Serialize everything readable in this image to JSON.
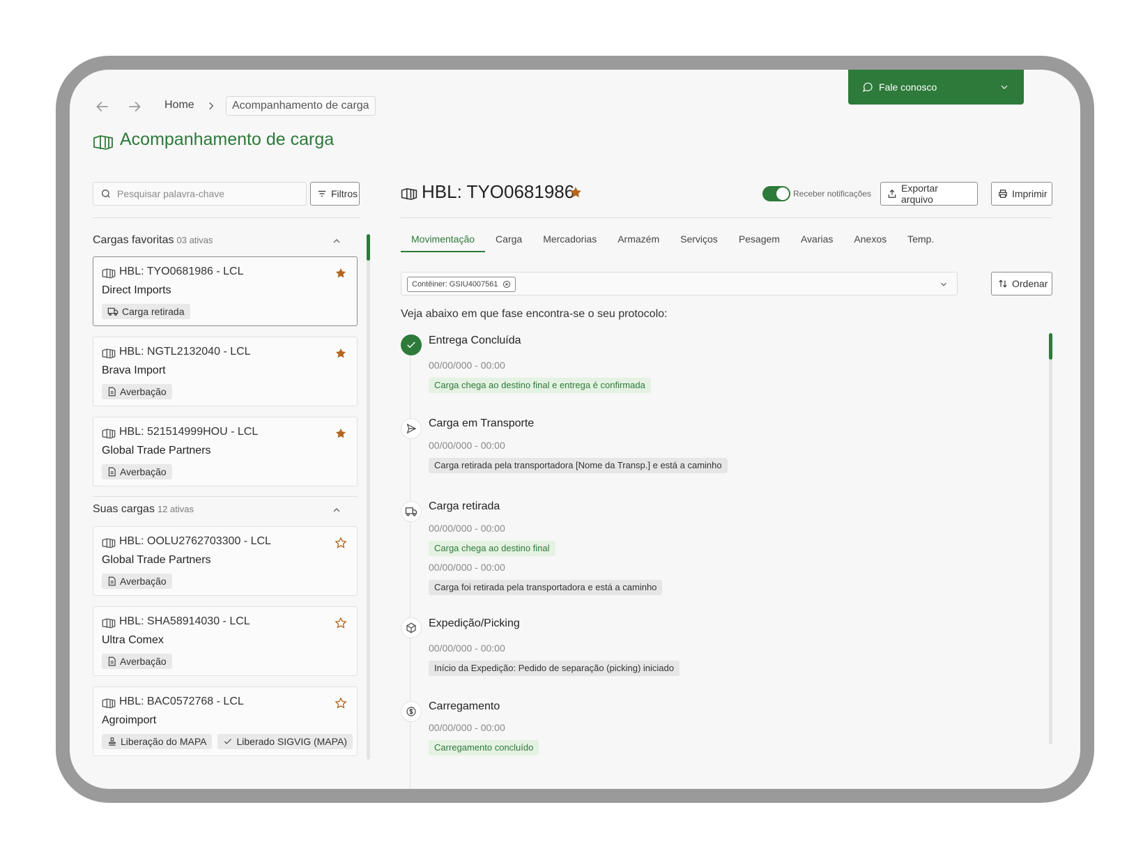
{
  "breadcrumb": {
    "home": "Home",
    "current": "Acompanhamento de carga"
  },
  "chat": {
    "label": "Fale conosco"
  },
  "page": {
    "title": "Acompanhamento de carga"
  },
  "search": {
    "placeholder": "Pesquisar palavra-chave",
    "filters_label": "Filtros"
  },
  "favorites": {
    "title": "Cargas favoritas",
    "count": "03 ativas",
    "items": [
      {
        "hbl": "HBL: TYO0681986 - LCL",
        "company": "Direct Imports",
        "tags": [
          "Carga retirada"
        ],
        "starred": true
      },
      {
        "hbl": "HBL: NGTL2132040 - LCL",
        "company": "Brava Import",
        "tags": [
          "Averbação"
        ],
        "starred": true
      },
      {
        "hbl": "HBL: 521514999HOU - LCL",
        "company": "Global Trade Partners",
        "tags": [
          "Averbação"
        ],
        "starred": true
      }
    ]
  },
  "yours": {
    "title": "Suas cargas",
    "count": "12 ativas",
    "items": [
      {
        "hbl": "HBL: OOLU2762703300 - LCL",
        "company": "Global Trade Partners",
        "tags": [
          "Averbação"
        ],
        "starred": false
      },
      {
        "hbl": "HBL: SHA58914030 - LCL",
        "company": "Ultra Comex",
        "tags": [
          "Averbação"
        ],
        "starred": false
      },
      {
        "hbl": "HBL: BAC0572768 - LCL",
        "company": "Agroimport",
        "tags": [
          "Liberação do MAPA",
          "Liberado SIGVIG (MAPA)"
        ],
        "starred": false
      }
    ]
  },
  "detail": {
    "title": "HBL: TYO0681986",
    "notify_label": "Receber notificações",
    "export_label": "Exportar arquivo",
    "print_label": "Imprimir",
    "tabs": [
      "Movimentação",
      "Carga",
      "Mercadorias",
      "Armazém",
      "Serviços",
      "Pesagem",
      "Avarias",
      "Anexos",
      "Temp."
    ],
    "container_chip": "Contêiner: GSIU4007561",
    "sort_label": "Ordenar",
    "protocol_text": "Veja abaixo em que fase encontra-se o seu protocolo:"
  },
  "timeline": [
    {
      "title": "Entrega Concluída",
      "icon": "check-icon",
      "events": [
        {
          "date": "00/00/000 - 00:00",
          "text": "Carga chega ao destino final e entrega é confirmada",
          "tone": "green"
        }
      ]
    },
    {
      "title": "Carga em Transporte",
      "icon": "send-icon",
      "events": [
        {
          "date": "00/00/000 - 00:00",
          "text": "Carga retirada pela transportadora [Nome da Transp.] e está a caminho",
          "tone": "neutral"
        }
      ]
    },
    {
      "title": "Carga retirada",
      "icon": "truck-icon",
      "events": [
        {
          "date": "00/00/000 - 00:00",
          "text": "Carga chega ao destino final",
          "tone": "green"
        },
        {
          "date": "00/00/000 - 00:00",
          "text": "Carga foi retirada pela transportadora e está a caminho",
          "tone": "neutral"
        }
      ]
    },
    {
      "title": "Expedição/Picking",
      "icon": "package-icon",
      "events": [
        {
          "date": "00/00/000 - 00:00",
          "text": "Início da Expedição: Pedido de separação (picking) iniciado",
          "tone": "neutral"
        }
      ]
    },
    {
      "title": "Carregamento",
      "icon": "dollar-circle-icon",
      "events": [
        {
          "date": "00/00/000 - 00:00",
          "text": "Carregamento concluído",
          "tone": "green"
        }
      ]
    }
  ],
  "colors": {
    "brand": "#2d7a3a",
    "star": "#b5651d"
  }
}
